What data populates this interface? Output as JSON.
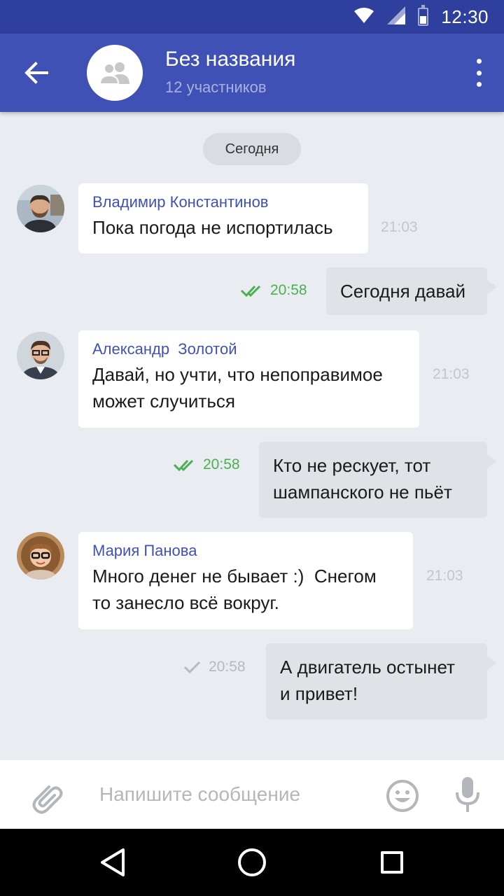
{
  "status_bar": {
    "time": "12:30"
  },
  "header": {
    "title": "Без названия",
    "subtitle": "12 участников"
  },
  "date_divider": "Сегодня",
  "messages": [
    {
      "direction": "in",
      "sender": "Владимир Константинов",
      "lines": [
        "Пока погода не испортилась"
      ],
      "time": "21:03"
    },
    {
      "direction": "out",
      "lines": [
        "Сегодня давай"
      ],
      "time": "20:58",
      "status": "read"
    },
    {
      "direction": "in",
      "sender": "Александр  Золотой",
      "lines": [
        "Давай, но учти, что непоправимое",
        "может случиться"
      ],
      "time": "21:03"
    },
    {
      "direction": "out",
      "lines": [
        "Кто не рескует, тот",
        "шампанского не пьёт"
      ],
      "time": "20:58",
      "status": "read"
    },
    {
      "direction": "in",
      "sender": "Мария Панова",
      "lines": [
        "Много денег не бывает :)  Снегом",
        "то занесло всё вокруг."
      ],
      "time": "21:03"
    },
    {
      "direction": "out",
      "lines": [
        "А двигатель остынет",
        "и привет!"
      ],
      "time": "20:58",
      "status": "sent"
    }
  ],
  "composer": {
    "placeholder": "Напишите сообщение"
  },
  "colors": {
    "primary": "#3f51b5",
    "status_bar": "#2f3f9e",
    "read_check": "#4caf50",
    "background": "#e9ecf0"
  },
  "icons": {
    "back": "arrow-left-icon",
    "group": "group-icon",
    "more": "more-vert-icon",
    "attach": "paperclip-icon",
    "emoji": "smiley-icon",
    "mic": "microphone-icon"
  }
}
